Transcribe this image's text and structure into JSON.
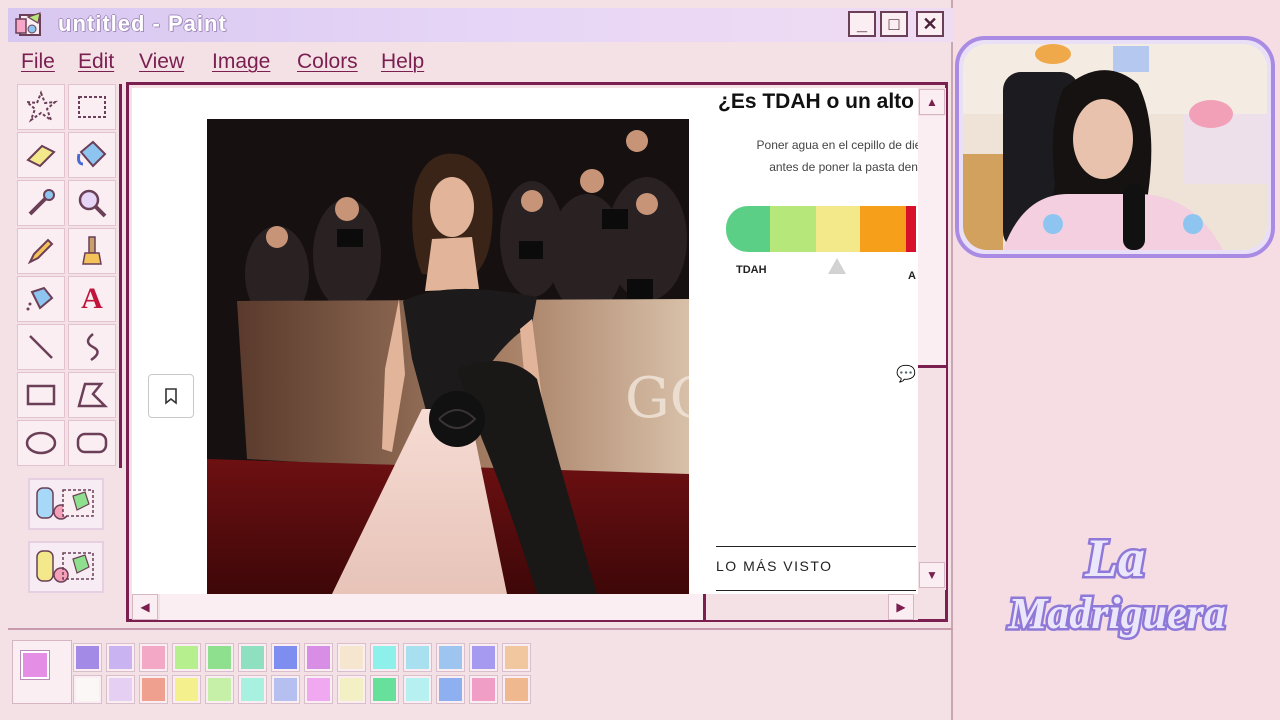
{
  "window": {
    "title": "untitled - Paint",
    "minimize_label": "_",
    "maximize_label": "□",
    "close_label": "✕"
  },
  "menu": [
    "File",
    "Edit",
    "View",
    "Image",
    "Colors",
    "Help"
  ],
  "tools": [
    {
      "name": "free-form-select-icon"
    },
    {
      "name": "rect-select-icon"
    },
    {
      "name": "eraser-icon"
    },
    {
      "name": "fill-bucket-icon"
    },
    {
      "name": "color-picker-icon"
    },
    {
      "name": "magnifier-icon"
    },
    {
      "name": "pencil-icon"
    },
    {
      "name": "brush-icon"
    },
    {
      "name": "airbrush-icon"
    },
    {
      "name": "text-icon",
      "glyph": "A"
    },
    {
      "name": "line-icon"
    },
    {
      "name": "curve-icon"
    },
    {
      "name": "rectangle-icon"
    },
    {
      "name": "polygon-icon"
    },
    {
      "name": "ellipse-icon"
    },
    {
      "name": "rounded-rect-icon"
    }
  ],
  "article": {
    "title": "¿Es TDAH o un alto",
    "subtitle_line1": "Poner agua en el cepillo de dien",
    "subtitle_line2": "antes de poner la pasta denta",
    "meter_low_label": "TDAH",
    "meter_high_label": "A",
    "meter_colors": [
      "#5ccf86",
      "#b6e77b",
      "#f3e98a",
      "#f59f1b",
      "#d8102a"
    ],
    "most_seen": "LO MÁS VISTO",
    "bookmark_icon": "bookmark-icon",
    "photo_text": "GO"
  },
  "palette": {
    "foreground": "#e58ee6",
    "background": "#fbeef2",
    "row1": [
      "#a28ae6",
      "#c9b3f0",
      "#f3a8c5",
      "#b6ef8e",
      "#8ee08e",
      "#8ee0c0",
      "#7e8ef0",
      "#d98ee6",
      "#f7e6cf",
      "#8ef0ea",
      "#a8e0f0",
      "#9ec5f0",
      "#a69af0",
      "#f0c79e"
    ],
    "row2": [
      "#fbf7f7",
      "#e5d0f3",
      "#f0a08e",
      "#f4f08e",
      "#c6f0a8",
      "#a8f0e0",
      "#b6c0f0",
      "#f0a8f0",
      "#f4f0c6",
      "#66e09a",
      "#b6f0f0",
      "#8eb0f0",
      "#f09ec5",
      "#f0b88e"
    ]
  },
  "brand": {
    "line1": "La",
    "line2": "Madriguera"
  }
}
